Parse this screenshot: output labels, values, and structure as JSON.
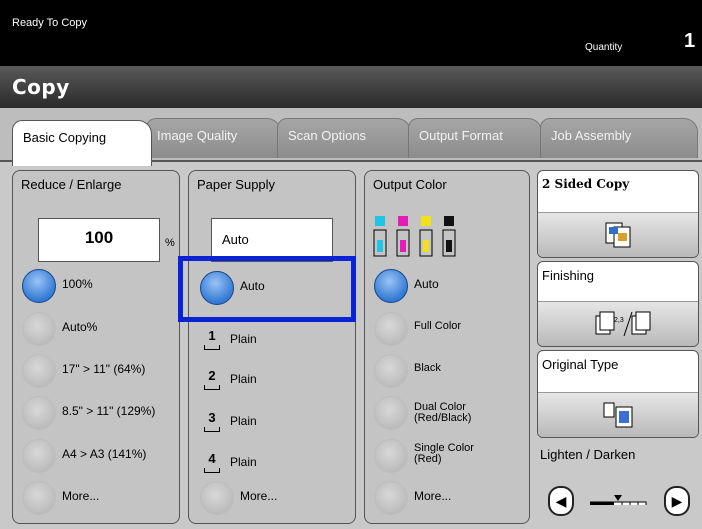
{
  "status": "Ready To Copy",
  "quantity": {
    "label": "Quantity",
    "value": "1"
  },
  "title": "Copy",
  "tabs": [
    "Basic Copying",
    "Image Quality",
    "Scan Options",
    "Output Format",
    "Job Assembly"
  ],
  "reduce_enlarge": {
    "title": "Reduce / Enlarge",
    "value": "100",
    "unit": "%",
    "options": [
      "100%",
      "Auto%",
      "17\" > 11\" (64%)",
      "8.5\" > 11\" (129%)",
      "A4 > A3 (141%)",
      "More..."
    ],
    "selected_index": 0
  },
  "paper_supply": {
    "title": "Paper Supply",
    "value": "Auto",
    "auto_label": "Auto",
    "trays": [
      {
        "number": "1",
        "label": "Plain"
      },
      {
        "number": "2",
        "label": "Plain"
      },
      {
        "number": "3",
        "label": "Plain"
      },
      {
        "number": "4",
        "label": "Plain"
      }
    ],
    "more_label": "More..."
  },
  "output_color": {
    "title": "Output Color",
    "options": [
      {
        "line1": "Auto",
        "line2": ""
      },
      {
        "line1": "Full Color",
        "line2": ""
      },
      {
        "line1": "Black",
        "line2": ""
      },
      {
        "line1": "Dual Color",
        "line2": "(Red/Black)"
      },
      {
        "line1": "Single Color",
        "line2": "(Red)"
      },
      {
        "line1": "More...",
        "line2": ""
      }
    ],
    "selected_index": 0
  },
  "side": {
    "two_sided": "2 Sided Copy",
    "finishing": "Finishing",
    "original_type": "Original Type",
    "lighten_darken": "Lighten / Darken"
  },
  "colors": {
    "highlight": "#0b23d6",
    "radio_selected": "#3a7fd6"
  }
}
